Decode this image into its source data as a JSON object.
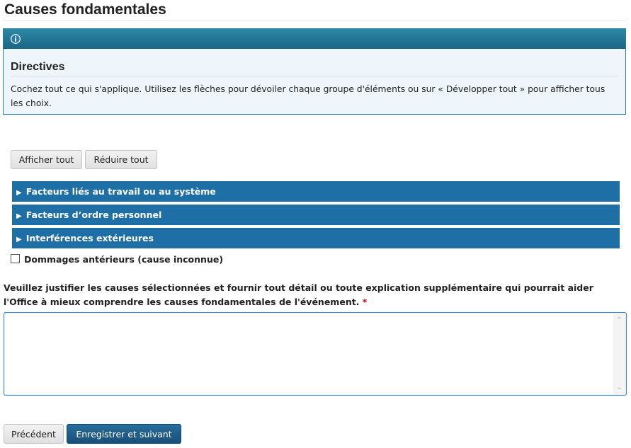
{
  "page": {
    "title": "Causes fondamentales"
  },
  "info": {
    "icon": "info-icon",
    "heading": "Directives",
    "text": "Cochez tout ce qui s'applique. Utilisez les flèches pour dévoiler chaque groupe d'éléments ou sur « Développer tout » pour afficher tous les choix."
  },
  "toolbar": {
    "show_all_label": "Afficher tout",
    "collapse_all_label": "Réduire tout"
  },
  "groups": [
    {
      "label": "Facteurs liés au travail ou au système",
      "icon": "triangle-right-icon"
    },
    {
      "label": "Facteurs d’ordre personnel",
      "icon": "triangle-right-icon"
    },
    {
      "label": "Interférences extérieures",
      "icon": "triangle-right-icon"
    }
  ],
  "checkbox": {
    "label": "Dommages antérieurs (cause inconnue)",
    "checked": false
  },
  "justification": {
    "question": "Veuillez justifier les causes sélectionnées et fournir tout détail ou toute explication supplémentaire qui pourrait aider l'Office à mieux comprendre les causes fondamentales de l'événement.",
    "required_marker": "*",
    "value": ""
  },
  "navigation": {
    "previous_label": "Précédent",
    "next_label": "Enregistrer et suivant"
  },
  "colors": {
    "accordion_bg": "#1d6fa6",
    "info_header": "#1a6585",
    "primary_button": "#174f78",
    "required": "#cc0000"
  }
}
